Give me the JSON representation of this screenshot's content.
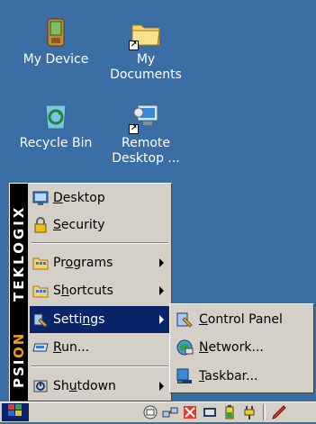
{
  "desktop": {
    "icons": [
      {
        "label": "My Device",
        "icon": "pda-icon"
      },
      {
        "label": "My Documents",
        "icon": "folder-icon"
      },
      {
        "label": "Recycle Bin",
        "icon": "recycle-bin-icon"
      },
      {
        "label": "Remote Desktop ...",
        "icon": "remote-desktop-icon"
      }
    ]
  },
  "start_menu": {
    "brand_top": "TEKLOGIX",
    "brand_bottom_a": "PSI",
    "brand_bottom_b": "ON",
    "items": [
      {
        "label_pre": "",
        "label_ul": "D",
        "label_post": "esktop",
        "icon": "desktop-icon"
      },
      {
        "label_pre": "",
        "label_ul": "S",
        "label_post": "ecurity",
        "icon": "lock-icon"
      },
      {
        "label_pre": "Pr",
        "label_ul": "o",
        "label_post": "grams",
        "icon": "programs-folder-icon"
      },
      {
        "label_pre": "S",
        "label_ul": "h",
        "label_post": "ortcuts",
        "icon": "shortcuts-folder-icon"
      },
      {
        "label_pre": "Setti",
        "label_ul": "n",
        "label_post": "gs",
        "icon": "settings-icon"
      },
      {
        "label_pre": "",
        "label_ul": "R",
        "label_post": "un...",
        "icon": "run-icon"
      },
      {
        "label_pre": "Sh",
        "label_ul": "u",
        "label_post": "tdown",
        "icon": "shutdown-icon"
      }
    ]
  },
  "settings_submenu": {
    "items": [
      {
        "label_pre": "",
        "label_ul": "C",
        "label_post": "ontrol Panel",
        "icon": "control-panel-icon"
      },
      {
        "label_pre": "",
        "label_ul": "N",
        "label_post": "etwork...",
        "icon": "network-icon"
      },
      {
        "label_pre": "",
        "label_ul": "T",
        "label_post": "askbar...",
        "icon": "taskbar-settings-icon"
      }
    ]
  },
  "colors": {
    "desktop_bg": "#3a6ea5",
    "menu_bg": "#d4d0c8",
    "highlight": "#0a246a",
    "brand_orange": "#f29b1c"
  }
}
